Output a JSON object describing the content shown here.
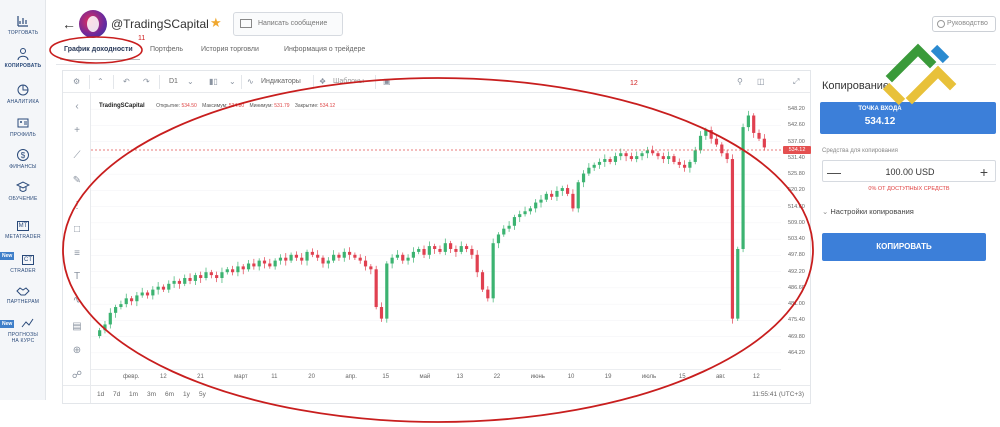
{
  "sidebar": {
    "items": [
      {
        "label": "ТОРГОВАТЬ",
        "icon": "chart-icon"
      },
      {
        "label": "КОПИРОВАТЬ",
        "icon": "users-icon"
      },
      {
        "label": "АНАЛИТИКА",
        "icon": "pie-icon"
      },
      {
        "label": "ПРОФИЛЬ",
        "icon": "profile-icon"
      },
      {
        "label": "ФИНАНСЫ",
        "icon": "dollar-icon"
      },
      {
        "label": "ОБУЧЕНИЕ",
        "icon": "graduation-icon"
      },
      {
        "label": "METATRADER",
        "icon": "mt-icon",
        "box": "MT"
      },
      {
        "label": "CTRADER",
        "icon": "ct-icon",
        "box": "CT",
        "badge": "New"
      },
      {
        "label": "ПАРТНЕРАМ",
        "icon": "partners-icon"
      },
      {
        "label": "ПРОГНОЗЫ НА КУРС",
        "icon": "forecast-icon",
        "badge": "New"
      }
    ]
  },
  "header": {
    "trader_name": "@TradingSCapital",
    "message_button": "Написать сообщение",
    "guide_button": "Руководство"
  },
  "tabs": [
    {
      "label": "График доходности",
      "active": true
    },
    {
      "label": "Портфель",
      "active": false
    },
    {
      "label": "История торговли",
      "active": false
    },
    {
      "label": "Информация о трейдере",
      "active": false
    }
  ],
  "annotations": {
    "tab_marker": "11",
    "chart_marker": "12"
  },
  "toolbar": {
    "timeframe": "D1",
    "indicators": "Индикаторы",
    "templates": "Шаблоны"
  },
  "legend": {
    "symbol": "TradingSCapital",
    "open_label": "Открытие:",
    "open": "534.50",
    "max_label": "Максимум:",
    "max": "534.80",
    "min_label": "Минимум:",
    "min": "531.79",
    "close_label": "Закрытие:",
    "close": "534.12"
  },
  "price_tag": "534.12",
  "bottom": {
    "ranges": [
      "1d",
      "7d",
      "1m",
      "3m",
      "6m",
      "1y",
      "5y"
    ],
    "clock": "11:55:41 (UTC+3)"
  },
  "copy_panel": {
    "title": "Копирование",
    "box_label": "ТОЧКА ВХОДА",
    "box_value": "534.12",
    "funds_label": "Средства для копирования",
    "amount": "100.00 USD",
    "note": "0% ОТ ДОСТУПНЫХ СРЕДСТВ",
    "settings": "Настройки копирования",
    "button": "КОПИРОВАТЬ"
  },
  "colors": {
    "up": "#3cb371",
    "down": "#e04050",
    "accent": "#3c7fd9",
    "annotation": "#c81e1e"
  },
  "chart_data": {
    "type": "candlestick",
    "price_ticks": [
      "548.20",
      "542.60",
      "537.00",
      "531.40",
      "525.80",
      "520.20",
      "514.60",
      "509.00",
      "503.40",
      "497.80",
      "492.20",
      "486.60",
      "481.00",
      "475.40",
      "469.80",
      "464.20"
    ],
    "time_ticks": [
      "февр.",
      "12",
      "21",
      "март",
      "11",
      "20",
      "апр.",
      "15",
      "май",
      "13",
      "22",
      "июнь",
      "10",
      "19",
      "июль",
      "15",
      "авг.",
      "12"
    ],
    "ylim": [
      461.4,
      551.0
    ],
    "current_price": 534.12,
    "closes": [
      472,
      474,
      478,
      480,
      481,
      483,
      482,
      484,
      485,
      484,
      486,
      487,
      486,
      488,
      489,
      488,
      490,
      489,
      491,
      490,
      492,
      491,
      490,
      492,
      493,
      492,
      494,
      493,
      495,
      494,
      496,
      495,
      494,
      496,
      497,
      496,
      498,
      497,
      496,
      499,
      498,
      497,
      495,
      496,
      498,
      497,
      499,
      498,
      497,
      496,
      494,
      493,
      480,
      476,
      495,
      497,
      498,
      496,
      497,
      499,
      500,
      498,
      501,
      500,
      499,
      502,
      500,
      499,
      501,
      500,
      498,
      492,
      486,
      483,
      502,
      505,
      507,
      508,
      511,
      512,
      513,
      514,
      516,
      517,
      519,
      518,
      520,
      521,
      519,
      514,
      523,
      526,
      528,
      529,
      530,
      531,
      530,
      532,
      533,
      532,
      531,
      532,
      533,
      534,
      533,
      532,
      531,
      532,
      530,
      529,
      528,
      530,
      534,
      539,
      541,
      538,
      536,
      533,
      531,
      476,
      500,
      542,
      546,
      540,
      538,
      535
    ]
  }
}
